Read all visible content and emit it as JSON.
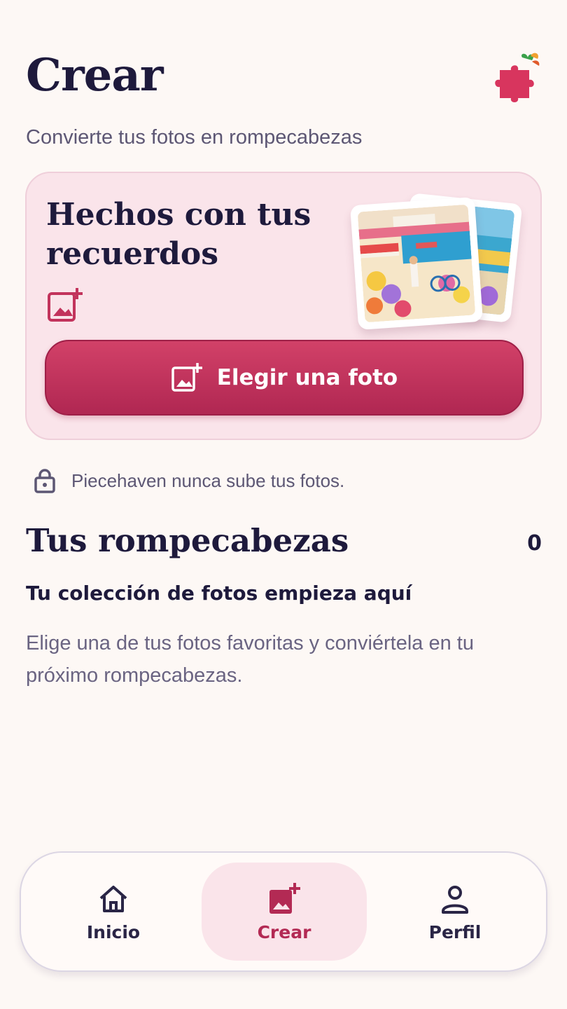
{
  "header": {
    "title": "Crear",
    "subtitle": "Convierte tus fotos en rompecabezas",
    "logo_icon": "puzzle-piece-icon"
  },
  "hero": {
    "title": "Hechos con tus recuerdos",
    "icon": "add-photo-icon",
    "button_label": "Elegir una foto",
    "button_icon": "add-photo-icon"
  },
  "privacy": {
    "icon": "lock-icon",
    "text": "Piecehaven nunca sube tus fotos."
  },
  "puzzles": {
    "title": "Tus rompecabezas",
    "count": "0",
    "empty_title": "Tu colección de fotos empieza aquí",
    "empty_description": "Elige una de tus fotos favoritas y conviértela en tu próximo rompecabezas."
  },
  "nav": {
    "items": [
      {
        "label": "Inicio",
        "icon": "home-icon",
        "active": false
      },
      {
        "label": "Crear",
        "icon": "add-photo-icon",
        "active": true
      },
      {
        "label": "Perfil",
        "icon": "person-icon",
        "active": false
      }
    ]
  },
  "colors": {
    "background": "#fdf8f5",
    "accent": "#c2335c",
    "card": "#fae4ea",
    "text": "#1e1a3c"
  }
}
